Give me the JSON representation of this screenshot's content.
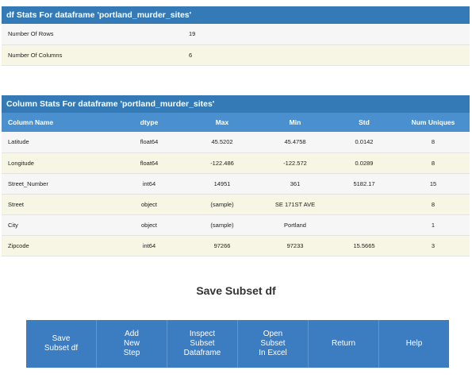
{
  "df_stats": {
    "title": "df Stats For dataframe 'portland_murder_sites'",
    "rows": [
      {
        "label": "Number Of Rows",
        "value": "19"
      },
      {
        "label": "Number Of Columns",
        "value": "6"
      }
    ]
  },
  "column_stats": {
    "title": "Column Stats For dataframe 'portland_murder_sites'",
    "headers": [
      "Column Name",
      "dtype",
      "Max",
      "Min",
      "Std",
      "Num Uniques"
    ],
    "rows": [
      [
        "Latitude",
        "float64",
        "45.5202",
        "45.4758",
        "0.0142",
        "8"
      ],
      [
        "Longitude",
        "float64",
        "-122.486",
        "-122.572",
        "0.0289",
        "8"
      ],
      [
        "Street_Number",
        "int64",
        "14951",
        "361",
        "5182.17",
        "15"
      ],
      [
        "Street",
        "object",
        "(sample)",
        "SE 171ST AVE",
        "",
        "8"
      ],
      [
        "City",
        "object",
        "(sample)",
        "Portland",
        "",
        "1"
      ],
      [
        "Zipcode",
        "int64",
        "97266",
        "97233",
        "15.5665",
        "3"
      ]
    ]
  },
  "save_section": {
    "title": "Save Subset df"
  },
  "buttons": [
    {
      "label": "Save\nSubset df"
    },
    {
      "label": "Add\nNew\nStep"
    },
    {
      "label": "Inspect\nSubset\nDataframe"
    },
    {
      "label": "Open\nSubset\nIn Excel"
    },
    {
      "label": "Return"
    },
    {
      "label": "Help"
    }
  ],
  "colors": {
    "header_blue": "#337ab7",
    "column_header_blue": "#4a90cf",
    "button_bar_blue": "#3b7dc0",
    "row_odd": "#f6f6f6",
    "row_even": "#f7f5e4"
  }
}
